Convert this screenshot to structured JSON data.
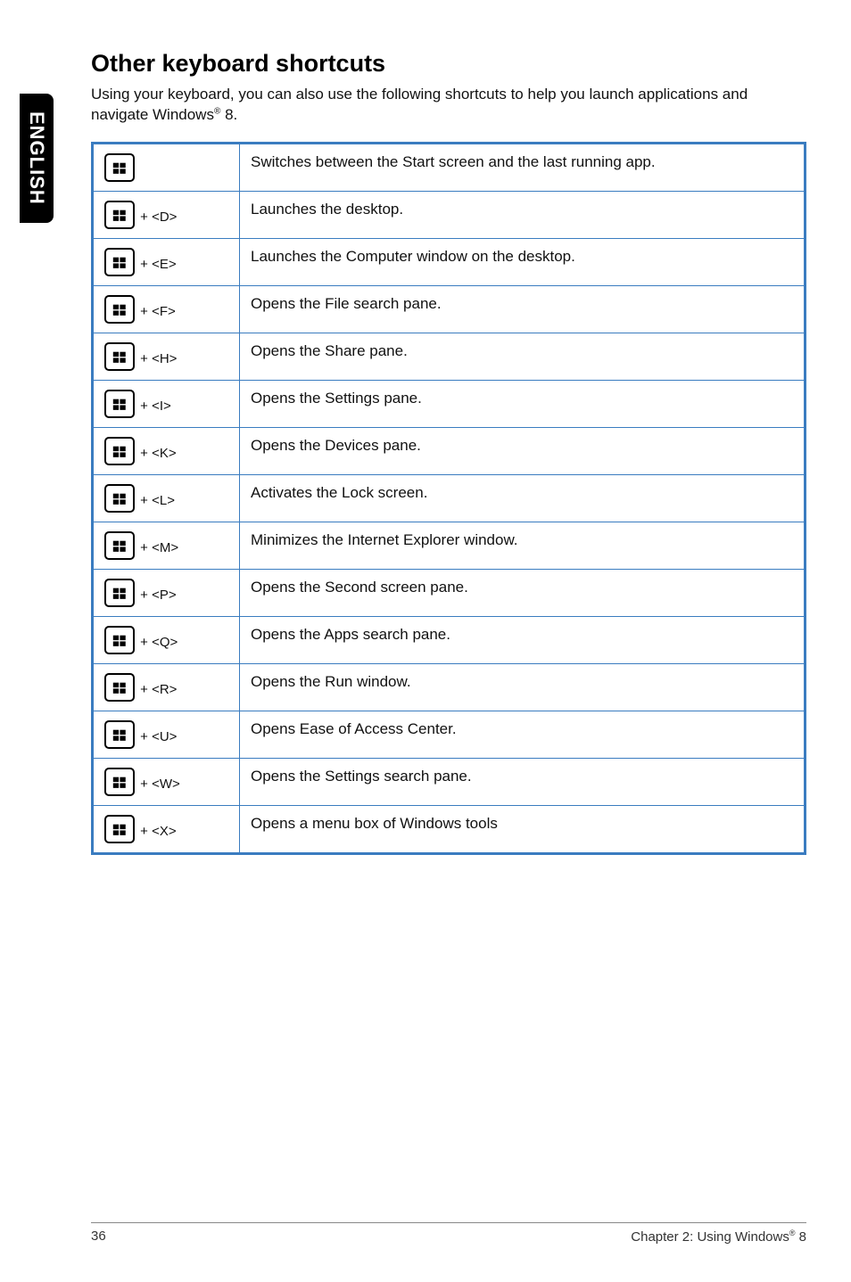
{
  "side_tab": "ENGLISH",
  "heading": "Other keyboard shortcuts",
  "intro_pre": "Using your keyboard, you can also use the following shortcuts to help you launch applications and navigate Windows",
  "intro_sup": "®",
  "intro_post": " 8.",
  "rows": [
    {
      "key": "",
      "desc": "Switches between the Start screen and the last running app."
    },
    {
      "key": " + <D>",
      "desc": "Launches the desktop."
    },
    {
      "key": " + <E>",
      "desc": "Launches the Computer window on the desktop."
    },
    {
      "key": " + <F>",
      "desc": "Opens the File search pane."
    },
    {
      "key": " + <H>",
      "desc": "Opens the Share pane."
    },
    {
      "key": " + <I>",
      "desc": "Opens the Settings pane."
    },
    {
      "key": " + <K>",
      "desc": "Opens the Devices pane."
    },
    {
      "key": " + <L>",
      "desc": "Activates the Lock screen."
    },
    {
      "key": " + <M>",
      "desc": "Minimizes the Internet Explorer window."
    },
    {
      "key": " + <P>",
      "desc": "Opens the Second screen pane."
    },
    {
      "key": " + <Q>",
      "desc": "Opens the Apps search pane."
    },
    {
      "key": " + <R>",
      "desc": "Opens the Run window."
    },
    {
      "key": " + <U>",
      "desc": "Opens Ease of Access Center."
    },
    {
      "key": " + <W>",
      "desc": "Opens the Settings search pane."
    },
    {
      "key": " + <X>",
      "desc": "Opens a menu box of Windows tools"
    }
  ],
  "footer": {
    "page": "36",
    "chapter_pre": "Chapter 2: Using Windows",
    "chapter_sup": "®",
    "chapter_post": " 8"
  }
}
